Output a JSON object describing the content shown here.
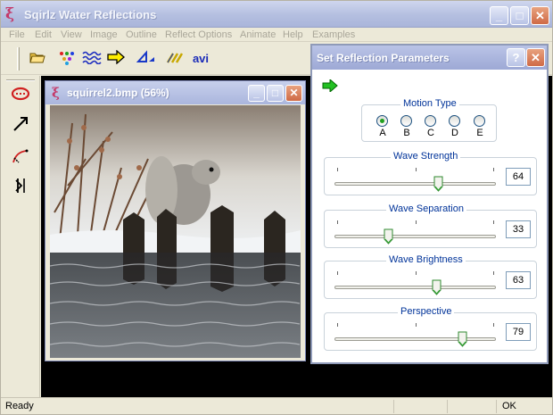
{
  "app": {
    "title": "Sqirlz Water Reflections",
    "icon": "app-logo-icon"
  },
  "menu": [
    "File",
    "Edit",
    "View",
    "Image",
    "Outline",
    "Reflect Options",
    "Animate",
    "Help",
    "Examples"
  ],
  "toolbar": {
    "items": [
      "open-folder-icon",
      "colored-dots-icon",
      "waves-icon",
      "arrow-right-icon",
      "perspective-icon",
      "brush-icon"
    ],
    "avi_label": "avi"
  },
  "left_tools": [
    "ellipse-select-icon",
    "line-arrow-icon",
    "curve-tool-icon",
    "flip-tool-icon"
  ],
  "image_window": {
    "title": "squirrel2.bmp  (56%)"
  },
  "dialog": {
    "title": "Set Reflection Parameters",
    "help_label": "?",
    "motion_type": {
      "label": "Motion Type",
      "options": [
        "A",
        "B",
        "C",
        "D",
        "E"
      ],
      "selected": "A"
    },
    "sliders": [
      {
        "label": "Wave Strength",
        "value": "64",
        "level": 0.64
      },
      {
        "label": "Wave Separation",
        "value": "33",
        "level": 0.33
      },
      {
        "label": "Wave Brightness",
        "value": "63",
        "level": 0.63
      },
      {
        "label": "Perspective",
        "value": "79",
        "level": 0.79
      }
    ]
  },
  "status": {
    "text": "Ready",
    "ok": "OK"
  },
  "colors": {
    "accent": "#003399",
    "selected_radio": "#21a121"
  }
}
